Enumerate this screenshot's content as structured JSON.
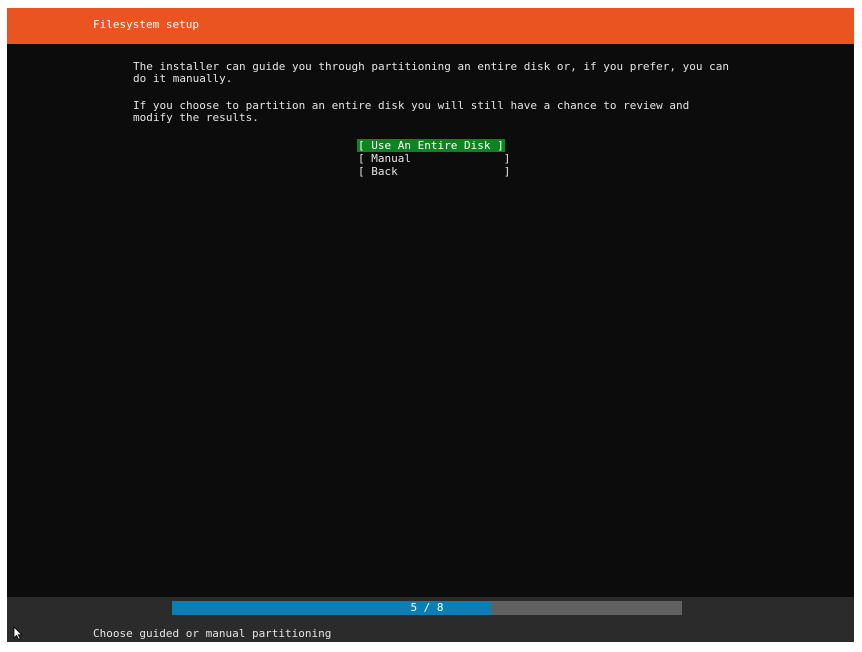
{
  "header": {
    "title": "Filesystem setup"
  },
  "body": {
    "paragraph_1": "The installer can guide you through partitioning an entire disk or, if you prefer, you can\ndo it manually.",
    "paragraph_2": "If you choose to partition an entire disk you will still have a chance to review and\nmodify the results."
  },
  "menu": {
    "items": [
      {
        "label": "[ Use An Entire Disk ]",
        "selected": true
      },
      {
        "label": "[ Manual              ]",
        "selected": false
      },
      {
        "label": "[ Back                ]",
        "selected": false
      }
    ]
  },
  "progress": {
    "label": "5 / 8",
    "current": 5,
    "total": 8
  },
  "footer": {
    "hint": "Choose guided or manual partitioning"
  },
  "colors": {
    "header_bg": "#e95420",
    "selected_bg": "#0e8420",
    "progress_fill": "#0a7fb5",
    "progress_track": "#606060"
  },
  "icons": {
    "pointer": "mouse-pointer-icon"
  }
}
